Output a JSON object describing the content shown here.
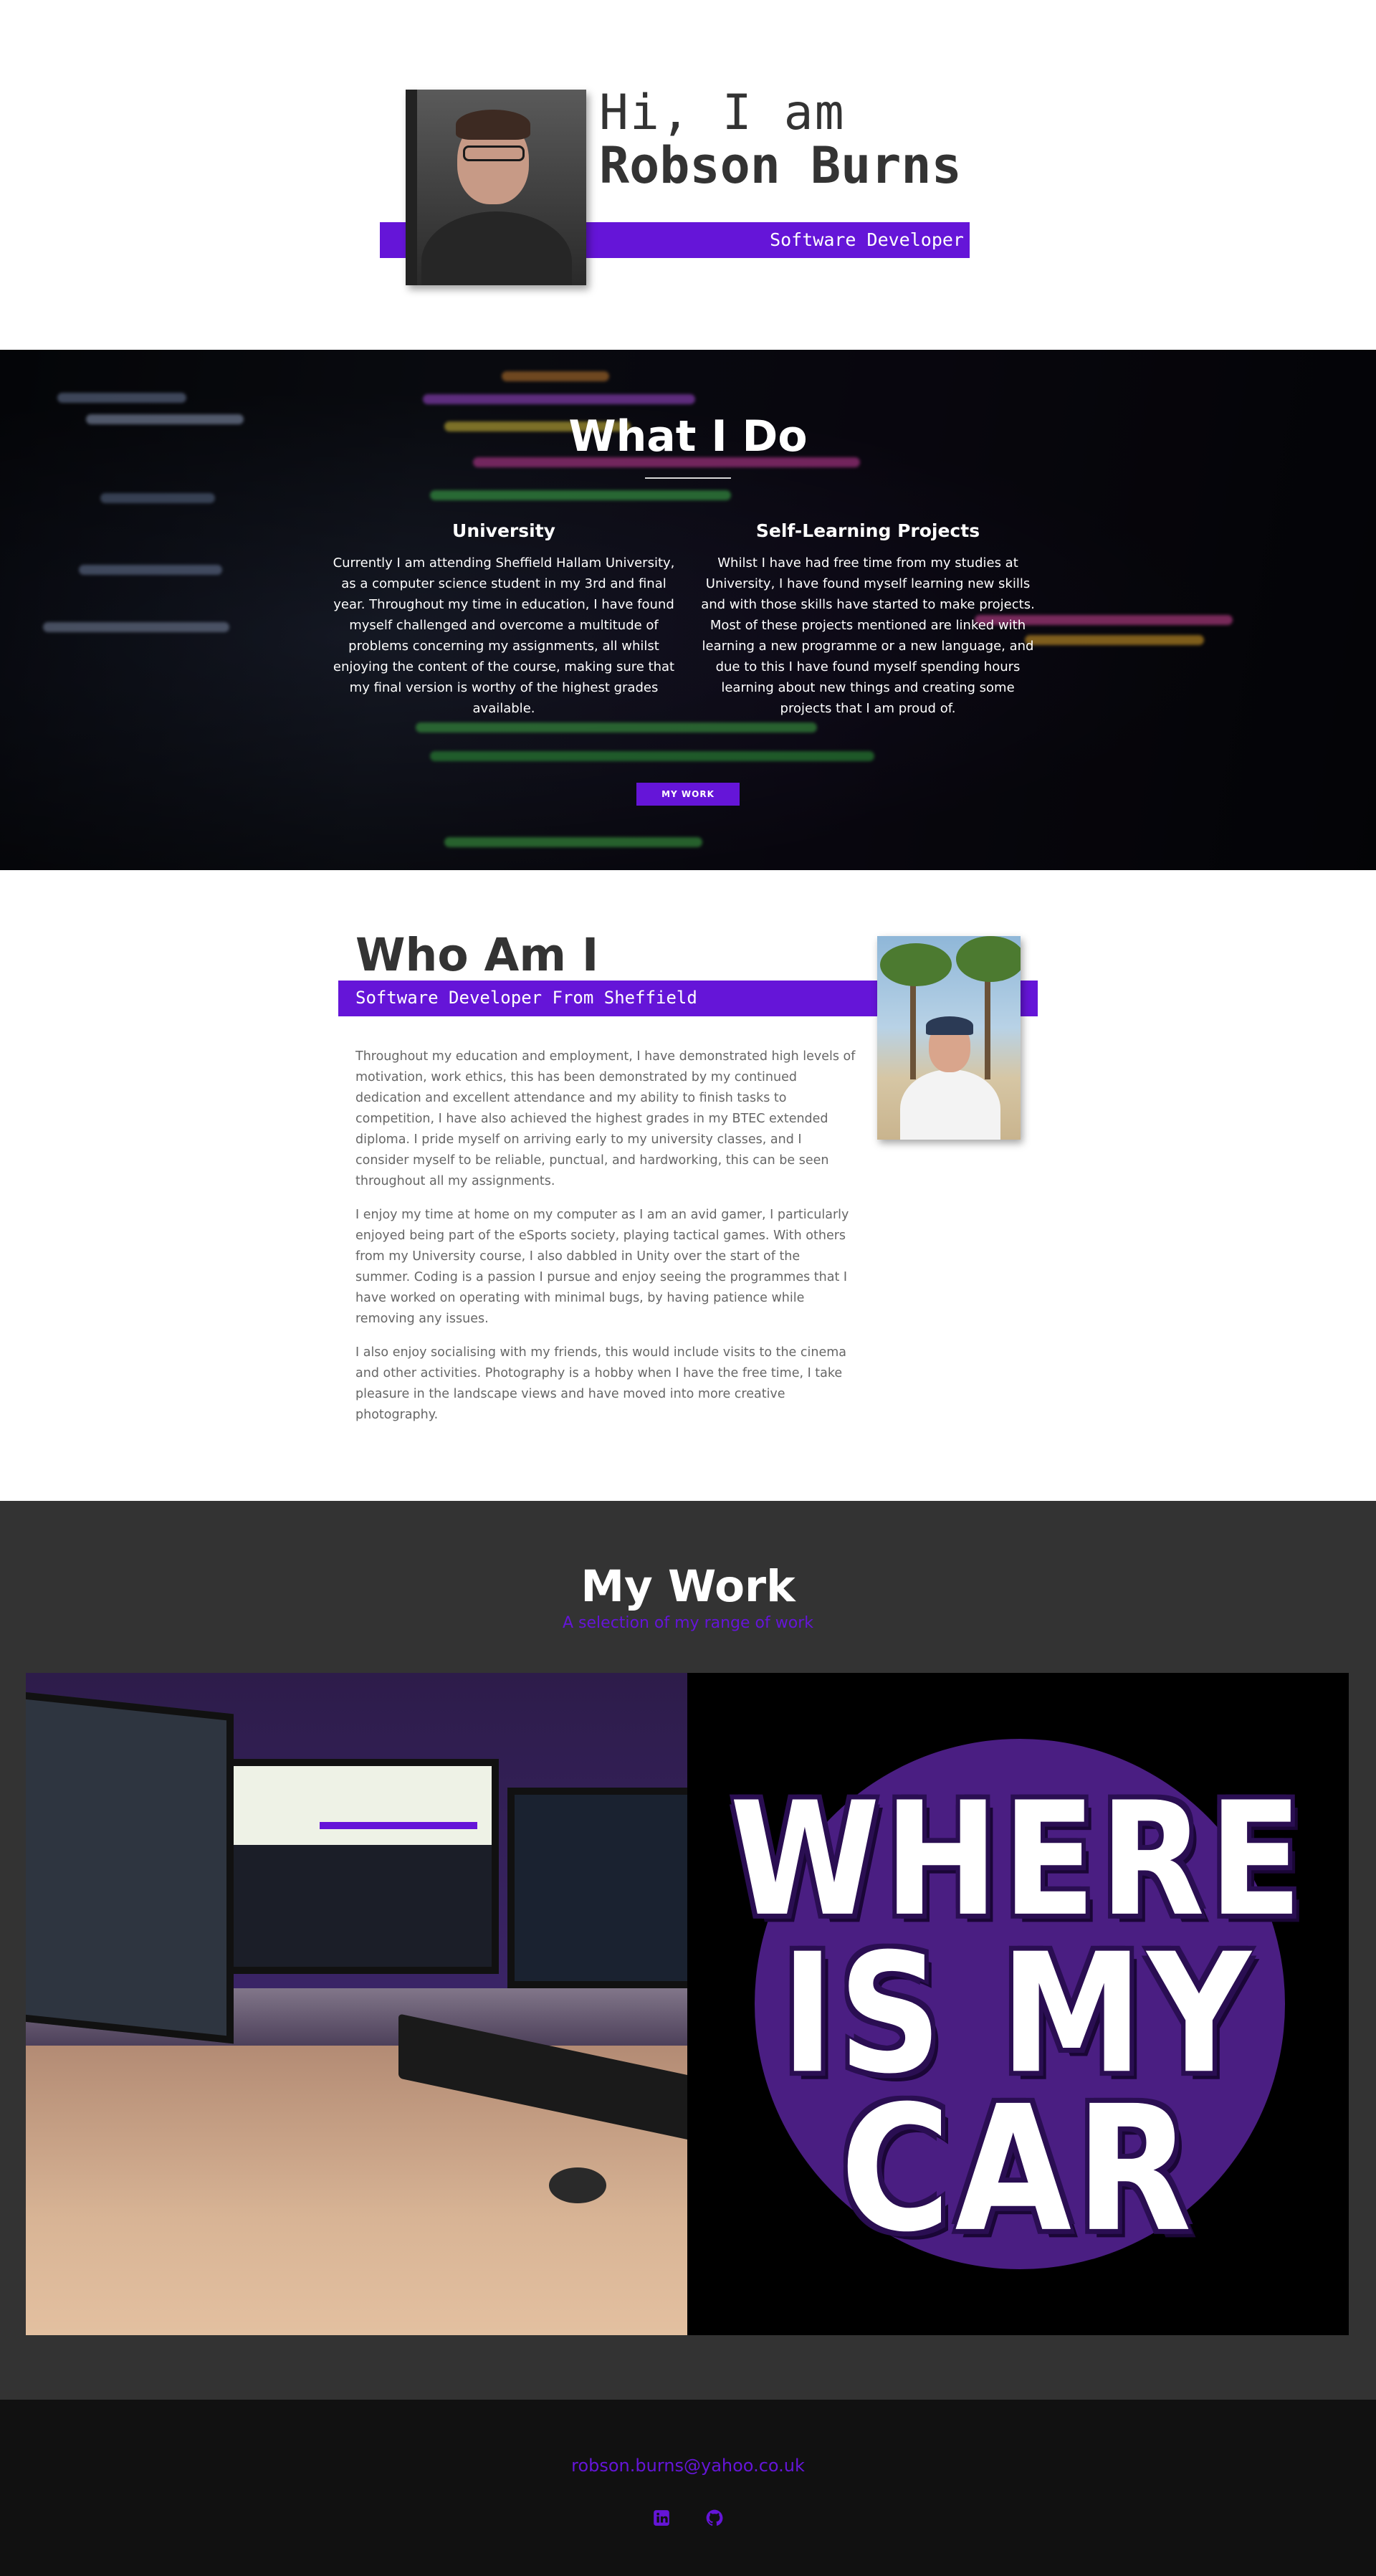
{
  "nav": {
    "menu_icon": "hamburger-menu-icon"
  },
  "hero": {
    "greeting": "Hi, I am",
    "name": "Robson Burns",
    "role": "Software Developer",
    "accent_color": "#6515d8"
  },
  "what_i_do": {
    "title": "What I Do",
    "columns": [
      {
        "heading": "University",
        "text": "Currently I am attending Sheffield Hallam University, as a computer science student in my 3rd and final year. Throughout my time in education, I have found myself challenged and overcome a multitude of problems concerning my assignments, all whilst enjoying the content of the course, making sure that my final version is worthy of the highest grades available."
      },
      {
        "heading": "Self-Learning Projects",
        "text": "Whilst I have had free time from my studies at University, I have found myself learning new skills and with those skills have started to make projects. Most of these projects mentioned are linked with learning a new programme or a new language, and due to this I have found myself spending hours learning about new things and creating some projects that I am proud of."
      }
    ],
    "button_label": "MY WORK"
  },
  "who_am_i": {
    "title": "Who Am I",
    "subtitle": "Software Developer From Sheffield",
    "paragraphs": [
      "Throughout my education and employment, I have demonstrated high levels of motivation, work ethics, this has been demonstrated by my continued dedication and excellent attendance and my ability to finish tasks to competition, I have also achieved the highest grades in my BTEC extended diploma. I pride myself on arriving early to my university classes, and I consider myself to be reliable, punctual, and hardworking, this can be seen throughout all my assignments.",
      "I enjoy my time at home on my computer as I am an avid gamer, I particularly enjoyed being part of the eSports society, playing tactical games. With others from my University course, I also dabbled in Unity over the start of the summer. Coding is a passion I pursue and enjoy seeing the programmes that I have worked on operating with minimal bugs, by having patience while removing any issues.",
      "I also enjoy socialising with my friends, this would include visits to the cinema and other activities. Photography is a hobby when I have the free time, I take pleasure in the landscape views and have moved into more creative photography."
    ]
  },
  "my_work": {
    "title": "My Work",
    "subtitle": "A selection of my range of work",
    "projects": [
      {
        "name": "portfolio-desk-setup"
      },
      {
        "logo_text": [
          "WHERE",
          "IS MY",
          "CAR"
        ]
      }
    ]
  },
  "footer": {
    "email": "robson.burns@yahoo.co.uk",
    "icons": [
      "linkedin-icon",
      "github-icon"
    ]
  }
}
